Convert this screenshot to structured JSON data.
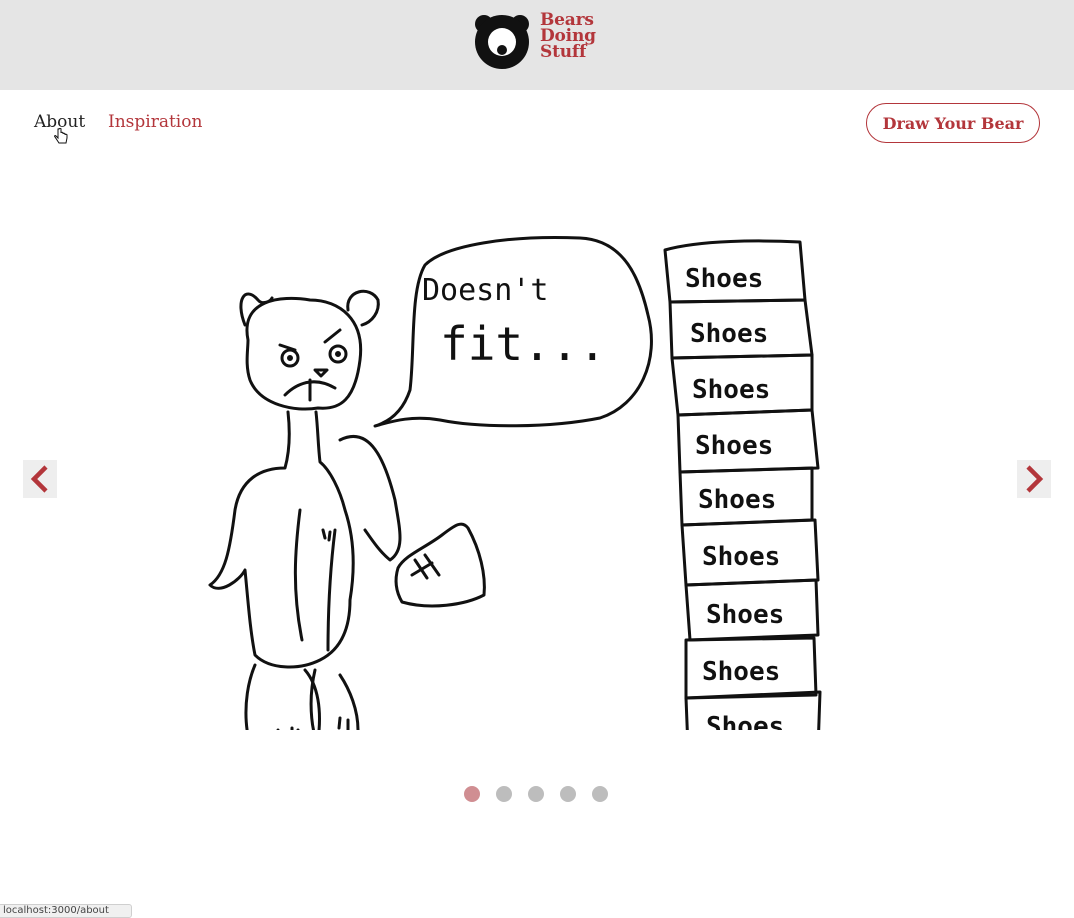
{
  "header": {
    "logo_line1": "Bears",
    "logo_line2": "Doing",
    "logo_line3": "Stuff"
  },
  "nav": {
    "about_label": "About",
    "inspiration_label": "Inspiration",
    "draw_button_label": "Draw Your Bear"
  },
  "slide": {
    "speech_line1": "Doesn't",
    "speech_line2": "fit...",
    "box_label": "Shoes"
  },
  "carousel": {
    "total_slides": 5,
    "active_slide": 1
  },
  "statusbar": {
    "url": "localhost:3000/about"
  },
  "colors": {
    "brand": "#b3363b",
    "header_bg": "#e5e5e5",
    "dot_active": "#d08e92",
    "dot_inactive": "#bdbdbd"
  }
}
